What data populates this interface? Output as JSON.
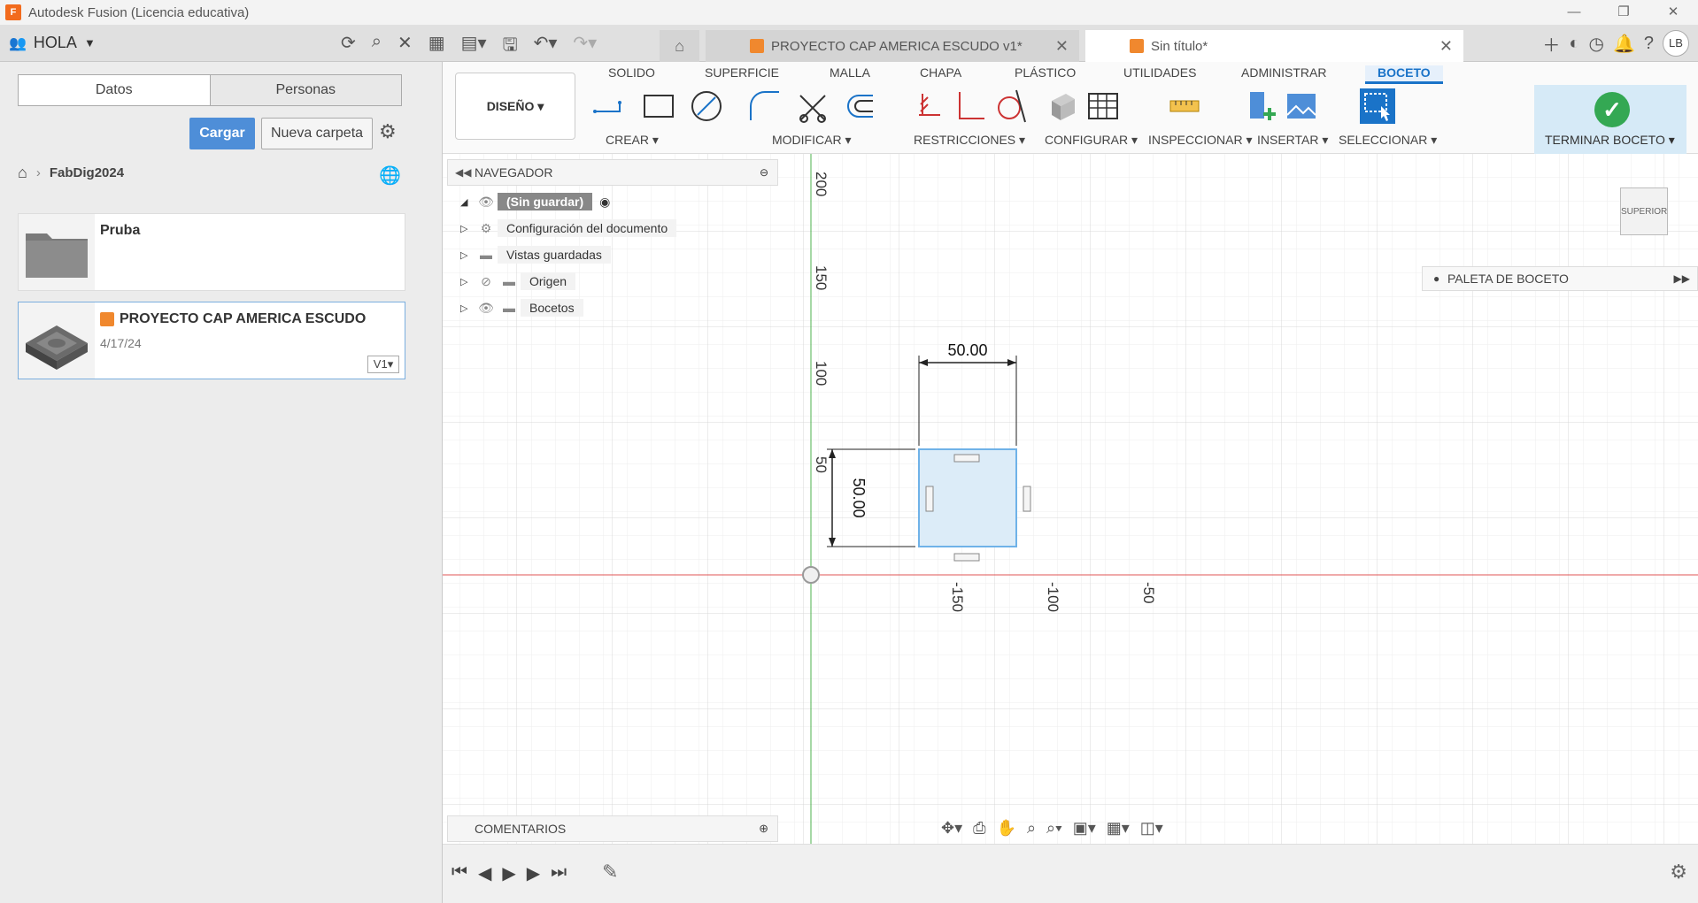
{
  "window": {
    "title": "Autodesk Fusion (Licencia educativa)",
    "logo_letter": "F"
  },
  "appbar": {
    "user_label": "HOLA",
    "tabs": [
      {
        "label": "PROYECTO CAP AMERICA ESCUDO v1*"
      },
      {
        "label": "Sin título*"
      }
    ],
    "avatar": "LB"
  },
  "data_panel": {
    "tabs": [
      "Datos",
      "Personas"
    ],
    "upload_label": "Cargar",
    "new_folder_label": "Nueva carpeta",
    "breadcrumb": "FabDig2024",
    "items": [
      {
        "name": "Pruba",
        "date": "",
        "version": ""
      },
      {
        "name": "PROYECTO CAP AMERICA ESCUDO",
        "date": "4/17/24",
        "version": "V1"
      }
    ]
  },
  "toolbar": {
    "workspace": "DISEÑO",
    "ribbon_tabs": [
      "SOLIDO",
      "SUPERFICIE",
      "MALLA",
      "CHAPA",
      "PLÁSTICO",
      "UTILIDADES",
      "ADMINISTRAR",
      "BOCETO"
    ],
    "groups": [
      "CREAR ▾",
      "MODIFICAR ▾",
      "RESTRICCIONES ▾",
      "CONFIGURAR ▾",
      "INSPECCIONAR ▾",
      "INSERTAR ▾",
      "SELECCIONAR ▾"
    ],
    "finish_label": "TERMINAR BOCETO ▾"
  },
  "navigator": {
    "title": "NAVEGADOR",
    "root": "(Sin guardar)",
    "items": [
      "Configuración del documento",
      "Vistas guardadas",
      "Origen",
      "Bocetos"
    ]
  },
  "palette": {
    "label": "PALETA DE BOCETO"
  },
  "viewcube": {
    "label": "SUPERIOR"
  },
  "comments": {
    "label": "COMENTARIOS"
  },
  "sketch": {
    "dimension_width": "50.00",
    "dimension_height": "50.00",
    "axis_labels_vertical": [
      "200",
      "150",
      "100",
      "50"
    ],
    "axis_labels_horizontal": [
      "-150",
      "-100",
      "-50"
    ]
  },
  "colors": {
    "accent": "#1a73c8",
    "finish": "#34a853",
    "x_axis": "#e05555",
    "y_axis": "#4cb04c",
    "sketch_fill": "#dcecf8",
    "sketch_stroke": "#6fb2e8"
  }
}
